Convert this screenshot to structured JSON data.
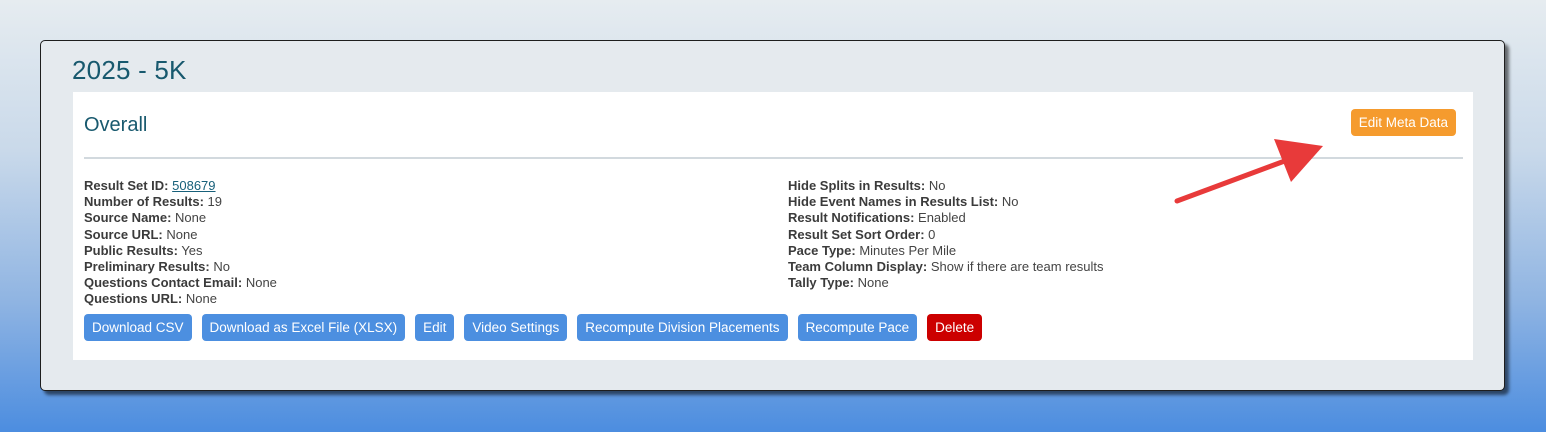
{
  "page": {
    "title": "2025 - 5K"
  },
  "result_set": {
    "section_title": "Overall",
    "edit_meta_label": "Edit Meta Data",
    "left_fields": [
      {
        "label": "Result Set ID:",
        "value": "508679",
        "is_link": true
      },
      {
        "label": "Number of Results:",
        "value": "19"
      },
      {
        "label": "Source Name:",
        "value": "None"
      },
      {
        "label": "Source URL:",
        "value": "None"
      },
      {
        "label": "Public Results:",
        "value": "Yes"
      },
      {
        "label": "Preliminary Results:",
        "value": "No"
      },
      {
        "label": "Questions Contact Email:",
        "value": "None"
      },
      {
        "label": "Questions URL:",
        "value": "None"
      }
    ],
    "right_fields": [
      {
        "label": "Hide Splits in Results:",
        "value": "No"
      },
      {
        "label": "Hide Event Names in Results List:",
        "value": "No"
      },
      {
        "label": "Result Notifications:",
        "value": "Enabled"
      },
      {
        "label": "Result Set Sort Order:",
        "value": "0"
      },
      {
        "label": "Pace Type:",
        "value": "Minutes Per Mile"
      },
      {
        "label": "Team Column Display:",
        "value": "Show if there are team results"
      },
      {
        "label": "Tally Type:",
        "value": "None"
      }
    ],
    "actions": {
      "download_csv": "Download CSV",
      "download_xlsx": "Download as Excel File (XLSX)",
      "edit": "Edit",
      "video_settings": "Video Settings",
      "recompute_division": "Recompute Division Placements",
      "recompute_pace": "Recompute Pace",
      "delete": "Delete"
    }
  },
  "colors": {
    "title": "#18596e",
    "primary_button": "#4c8fe0",
    "meta_button": "#f59b2e",
    "delete_button": "#cc0000",
    "annotation_arrow": "#e83a3a"
  },
  "annotation": {
    "icon": "red-arrow-icon",
    "points_to": "edit-meta-data-button"
  }
}
